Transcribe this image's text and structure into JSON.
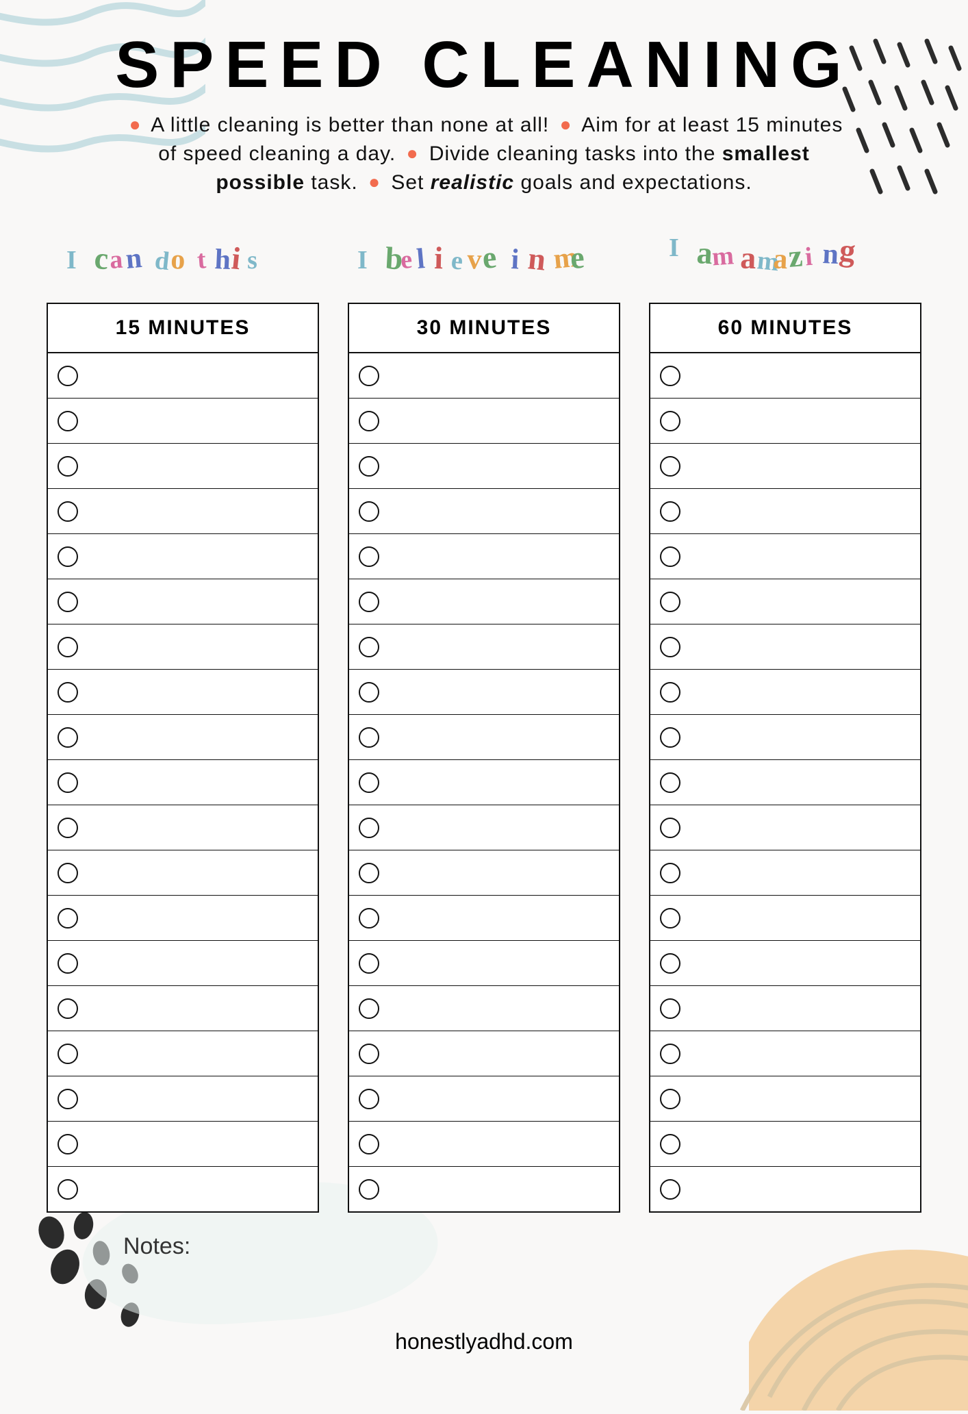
{
  "title": "SPEED CLEANING",
  "intro": {
    "tip1": "A little cleaning is better than none at all!",
    "tip2_a": "Aim for at least 15 minutes of speed cleaning a day.",
    "tip3_a": "Divide cleaning tasks into the ",
    "tip3_bold": "smallest possible",
    "tip3_b": " task.",
    "tip4_a": "Set ",
    "tip4_italic": "realistic",
    "tip4_b": " goals and expectations."
  },
  "columns": [
    {
      "affirmation": "I can do this",
      "header": "15 MINUTES",
      "rows": 19
    },
    {
      "affirmation": "I believe in me",
      "header": "30 MINUTES",
      "rows": 19
    },
    {
      "affirmation": "I am amazing",
      "header": "60 MINUTES",
      "rows": 19
    }
  ],
  "notes_label": "Notes:",
  "footer": "honestlyadhd.com",
  "palette": [
    "#7fb8c9",
    "#e7a24a",
    "#6aa86e",
    "#d96b9f",
    "#5e74c4",
    "#cf5a5a"
  ]
}
